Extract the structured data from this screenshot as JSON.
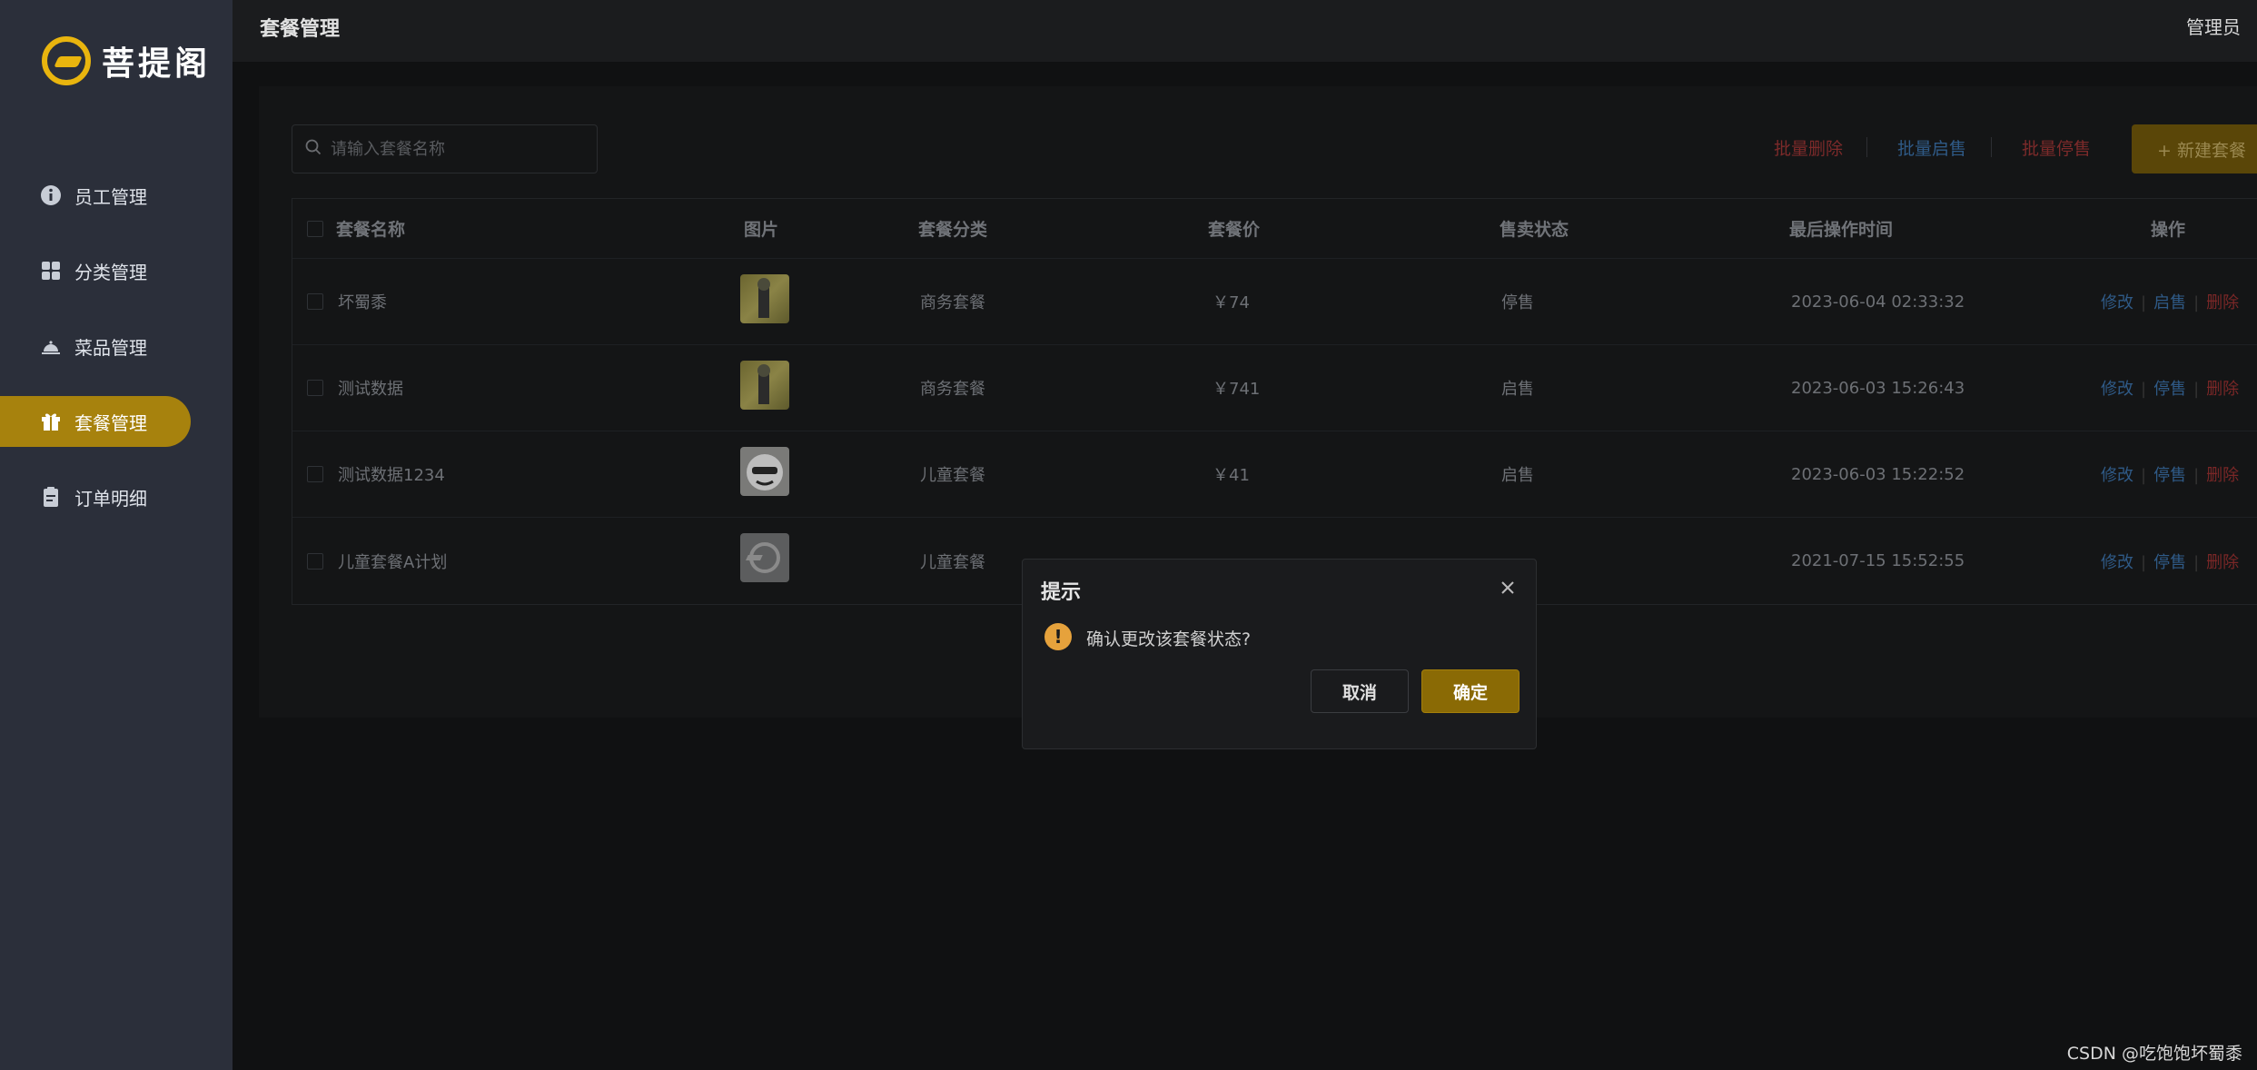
{
  "brand": {
    "name": "菩提阁",
    "accent": "#e9b50e",
    "active_bg": "#a7820d"
  },
  "sidebar": {
    "items": [
      {
        "label": "员工管理",
        "icon": "info-circle-icon",
        "active": false
      },
      {
        "label": "分类管理",
        "icon": "grid-icon",
        "active": false
      },
      {
        "label": "菜品管理",
        "icon": "dish-cover-icon",
        "active": false
      },
      {
        "label": "套餐管理",
        "icon": "gift-icon",
        "active": true
      },
      {
        "label": "订单明细",
        "icon": "clipboard-icon",
        "active": false
      }
    ]
  },
  "header": {
    "title": "套餐管理",
    "user": "管理员"
  },
  "toolbar": {
    "search_placeholder": "请输入套餐名称",
    "batch_delete": "批量删除",
    "batch_enable": "批量启售",
    "batch_disable": "批量停售",
    "new_button": "+ 新建套餐"
  },
  "table": {
    "columns": [
      "套餐名称",
      "图片",
      "套餐分类",
      "套餐价",
      "售卖状态",
      "最后操作时间",
      "操作"
    ],
    "rows": [
      {
        "name": "坏蜀黍",
        "category": "商务套餐",
        "price": "￥74",
        "status": "停售",
        "time": "2023-06-04 02:33:32",
        "edit": "修改",
        "toggle": "启售",
        "delete": "删除"
      },
      {
        "name": "测试数据",
        "category": "商务套餐",
        "price": "￥741",
        "status": "启售",
        "time": "2023-06-03 15:26:43",
        "edit": "修改",
        "toggle": "停售",
        "delete": "删除"
      },
      {
        "name": "测试数据1234",
        "category": "儿童套餐",
        "price": "￥41",
        "status": "启售",
        "time": "2023-06-03 15:22:52",
        "edit": "修改",
        "toggle": "停售",
        "delete": "删除"
      },
      {
        "name": "儿童套餐A计划",
        "category": "儿童套餐",
        "price": "",
        "status": "",
        "time": "2021-07-15 15:52:55",
        "edit": "修改",
        "toggle": "停售",
        "delete": "删除"
      }
    ]
  },
  "dialog": {
    "title": "提示",
    "message": "确认更改该套餐状态?",
    "cancel": "取消",
    "confirm": "确定"
  },
  "watermark": "CSDN @吃饱饱坏蜀黍"
}
